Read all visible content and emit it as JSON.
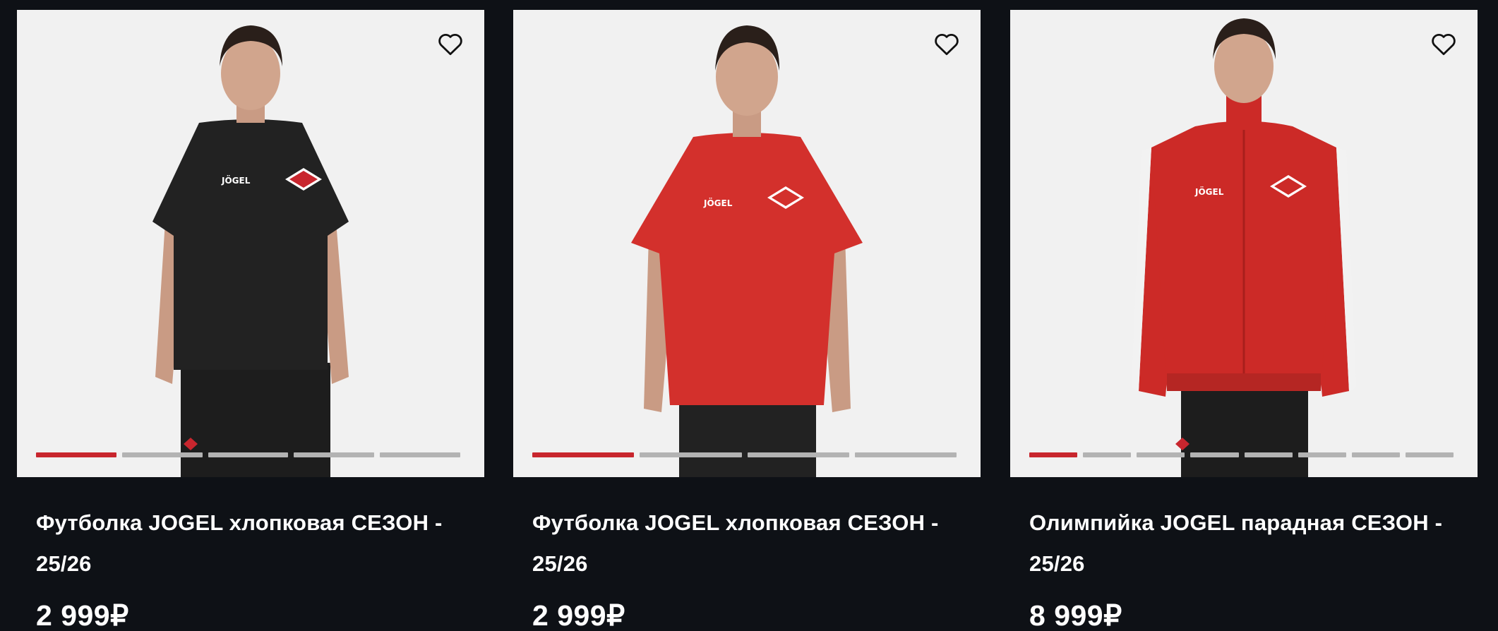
{
  "products": [
    {
      "title": "Футболка JOGEL хлопковая СЕЗОН - 25/26",
      "price": "2 999₽",
      "garment": "black-tshirt",
      "garment_color": "#222222",
      "image_count": 5,
      "active_image": 1
    },
    {
      "title": "Футболка JOGEL хлопковая СЕЗОН - 25/26",
      "price": "2 999₽",
      "garment": "red-tshirt",
      "garment_color": "#d3302c",
      "image_count": 4,
      "active_image": 1
    },
    {
      "title": "Олимпийка JOGEL парадная СЕЗОН - 25/26",
      "price": "8 999₽",
      "garment": "red-track-jacket",
      "garment_color": "#cc2a27",
      "image_count": 8,
      "active_image": 1
    }
  ],
  "icons": {
    "favorite": "heart-icon",
    "brand_logo": "jogel-logo",
    "club_crest": "spartak-crest"
  },
  "colors": {
    "background": "#0e1116",
    "photo_background": "#f1f1f1",
    "accent": "#c8262e",
    "indicator_inactive": "#b3b3b3",
    "text": "#ffffff"
  }
}
